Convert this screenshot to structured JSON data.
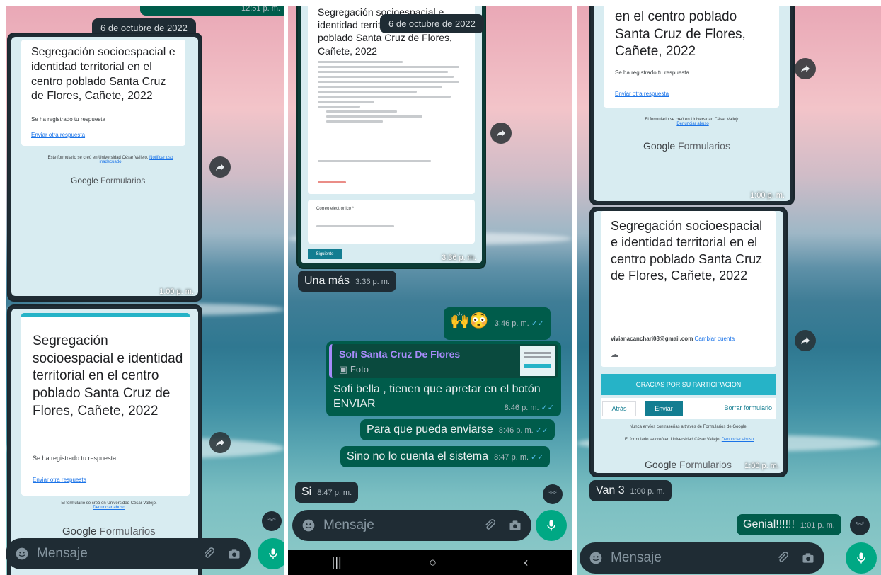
{
  "panel1": {
    "date_chip": "6 de octubre de 2022",
    "top_time": "12:51 p. m.",
    "card1": {
      "title": "Segregación socioespacial e identidad territorial en el centro poblado Santa Cruz de Flores, Cañete, 2022",
      "registered": "Se ha registrado tu respuesta",
      "another": "Enviar otra respuesta",
      "footer_note": "Este formulario se creó en Universidad César Vallejo.",
      "footer_link": "Notificar uso inadecuado",
      "brand_google": "Google",
      "brand_forms": "Formularios",
      "time": "1:00 p. m."
    },
    "card2": {
      "title": "Segregación socioespacial e identidad territorial en el centro poblado Santa Cruz de Flores, Cañete, 2022",
      "registered": "Se ha registrado tu respuesta",
      "another": "Enviar otra respuesta",
      "footer_note": "El formulario se creó en Universidad César Vallejo.",
      "footer_link": "Denunciar abuso",
      "brand_google": "Google",
      "brand_forms": "Formularios"
    },
    "composer_placeholder": "Mensaje"
  },
  "panel2": {
    "date_chip": "6 de octubre de 2022",
    "form_card": {
      "title": "Segregación socioespacial e identidad territorial en el centro poblado Santa Cruz de Flores, Cañete, 2022",
      "email_label": "Correo electrónico *",
      "next_button": "Siguiente",
      "time": "3:36 p. m."
    },
    "messages": [
      {
        "text": "Una más",
        "time": "3:36 p. m."
      },
      {
        "text": "🙌😳",
        "time": "3:46 p. m."
      },
      {
        "quote_author": "Sofi Santa Cruz De Flores",
        "quote_type": "Foto",
        "text": "Sofi bella , tienen que apretar en el botón ENVIAR",
        "time": "8:46 p. m."
      },
      {
        "text": "Para que pueda enviarse",
        "time": "8:46 p. m."
      },
      {
        "text": "Sino no lo cuenta el sistema",
        "time": "8:47 p. m."
      },
      {
        "text": "Si",
        "time": "8:47 p. m."
      }
    ],
    "composer_placeholder": "Mensaje"
  },
  "panel3": {
    "card_top": {
      "title_tail": "en el centro poblado Santa Cruz de Flores, Cañete, 2022",
      "registered": "Se ha registrado tu respuesta",
      "another": "Enviar otra respuesta",
      "footer_note": "El formulario se creó en Universidad César Vallejo.",
      "footer_link": "Denunciar abuso",
      "brand_google": "Google",
      "brand_forms": "Formularios",
      "time": "1:00 p. m."
    },
    "card_bottom": {
      "title": "Segregación socioespacial e identidad territorial en el centro poblado Santa Cruz de Flores, Cañete, 2022",
      "email": "vivianacanchari08@gmail.com",
      "switch_account": "Cambiar cuenta",
      "thanks": "GRACIAS POR SU PARTICIPACION",
      "back": "Atrás",
      "send": "Enviar",
      "clear": "Borrar formulario",
      "warning": "Nunca envíes contraseñas a través de Formularios de Google.",
      "footer_note": "El formulario se creó en Universidad César Vallejo.",
      "footer_link": "Denunciar abuso",
      "brand_google": "Google",
      "brand_forms": "Formularios",
      "time": "1:00 p. m."
    },
    "messages": [
      {
        "text": "Van 3",
        "time": "1:00 p. m."
      },
      {
        "text": "Genial!!!!!!",
        "time": "1:01 p. m."
      }
    ],
    "composer_placeholder": "Mensaje"
  },
  "colors": {
    "outgoing": "#005c4b",
    "incoming": "#1f2c34",
    "accent": "#00a884",
    "ticks": "#53bdeb"
  },
  "icons": [
    "forward-icon",
    "emoji-icon",
    "attach-icon",
    "camera-icon",
    "mic-icon",
    "chevron-down-icon",
    "nav-recents-icon",
    "nav-home-icon",
    "nav-back-icon",
    "cloud-icon"
  ]
}
